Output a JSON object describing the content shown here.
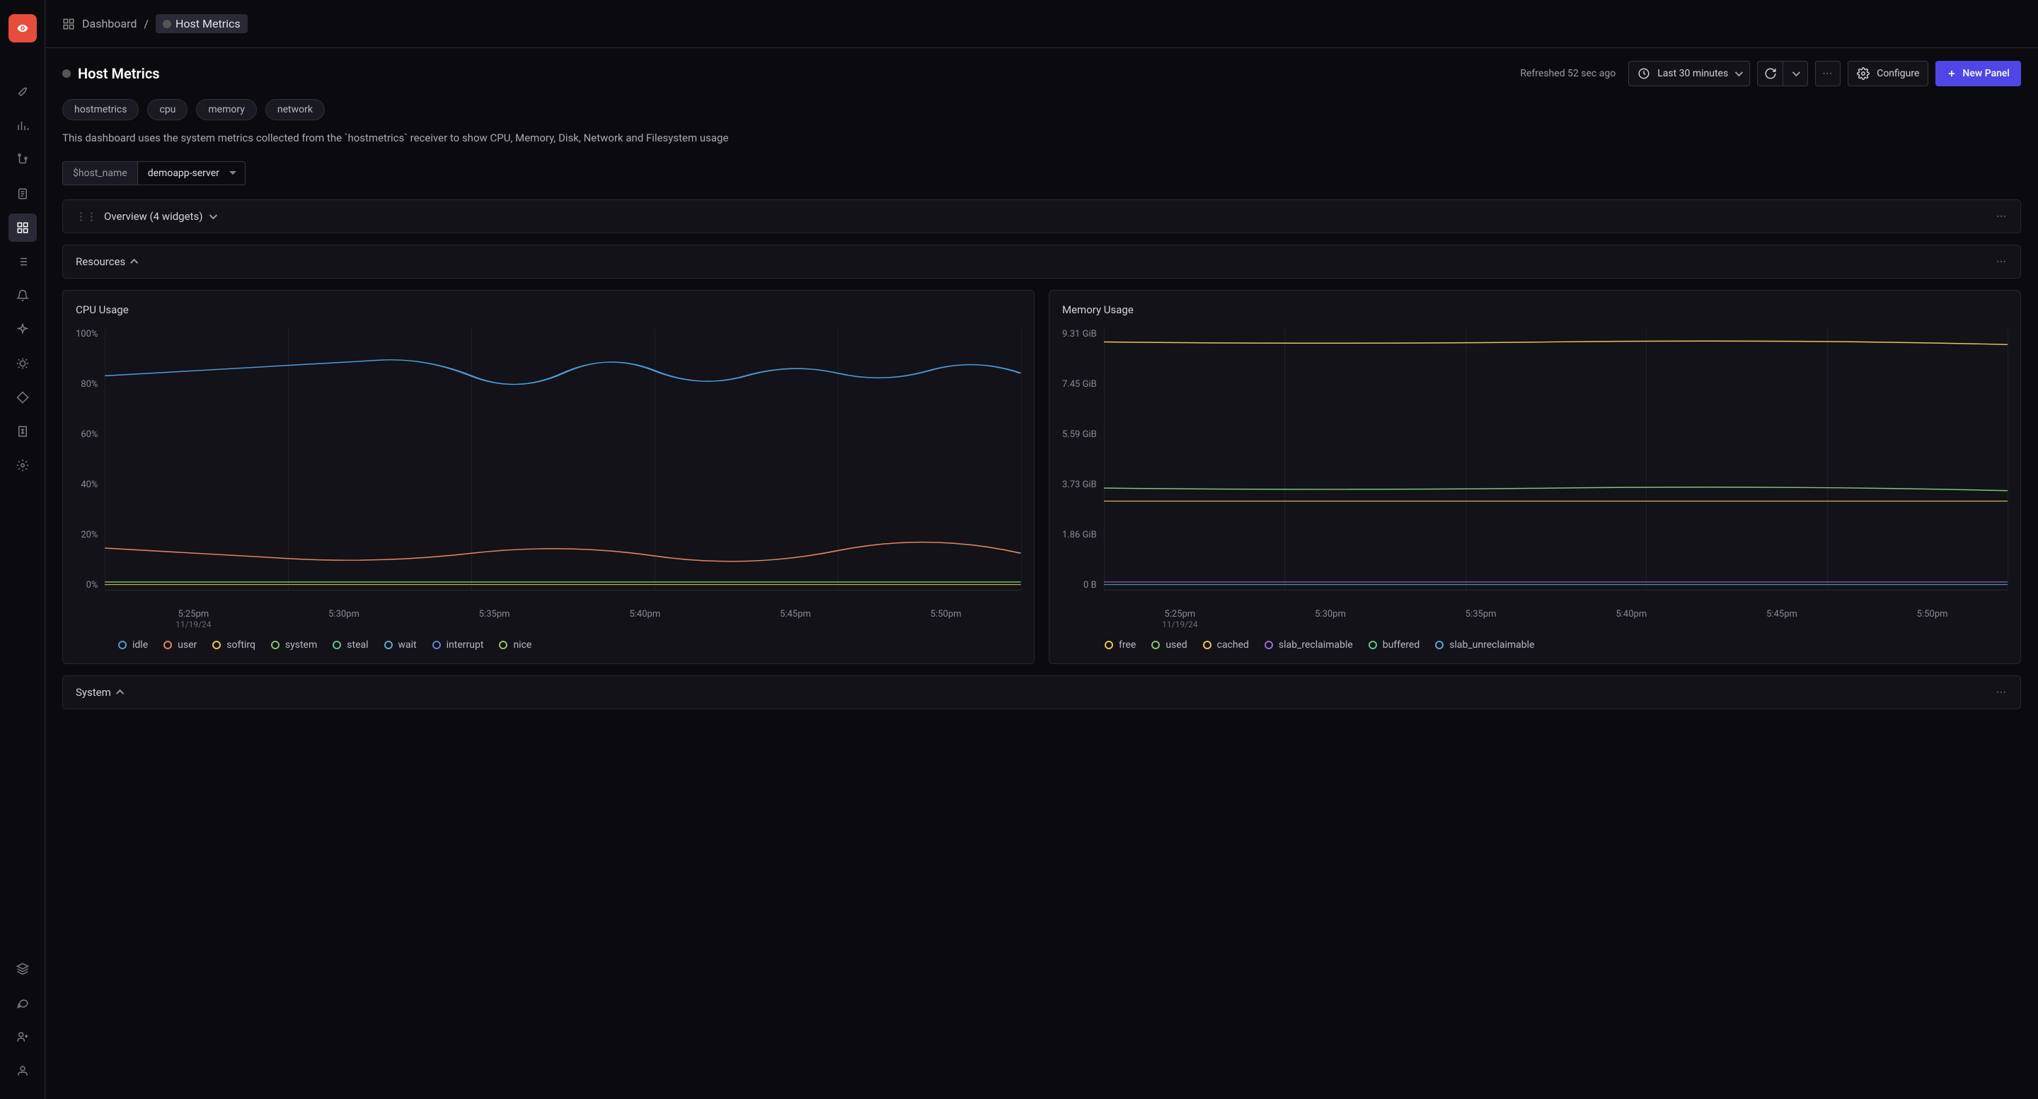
{
  "breadcrumb": {
    "root": "Dashboard",
    "sep": "/",
    "current": "Host Metrics"
  },
  "page": {
    "title": "Host Metrics",
    "refreshed": "Refreshed 52 sec ago",
    "time_range": "Last 30 minutes",
    "configure": "Configure",
    "new_panel": "New Panel",
    "description": "This dashboard uses the system metrics collected from the `hostmetrics` receiver to show CPU, Memory, Disk, Network and Filesystem usage"
  },
  "tags": [
    "hostmetrics",
    "cpu",
    "memory",
    "network"
  ],
  "variable": {
    "label": "$host_name",
    "value": "demoapp-server"
  },
  "sections": {
    "overview": "Overview (4 widgets)",
    "resources": "Resources",
    "system": "System"
  },
  "cpu_chart": {
    "title": "CPU Usage",
    "y_ticks": [
      "100%",
      "80%",
      "60%",
      "40%",
      "20%",
      "0%"
    ],
    "x_ticks": [
      "5:25pm",
      "5:30pm",
      "5:35pm",
      "5:40pm",
      "5:45pm",
      "5:50pm"
    ],
    "x_date": "11/19/24",
    "legend": [
      {
        "name": "idle",
        "color": "#4c9bd6"
      },
      {
        "name": "user",
        "color": "#e0835f"
      },
      {
        "name": "softirq",
        "color": "#e8c35b"
      },
      {
        "name": "system",
        "color": "#7fc66e"
      },
      {
        "name": "steal",
        "color": "#5bc48e"
      },
      {
        "name": "wait",
        "color": "#5ba8c4"
      },
      {
        "name": "interrupt",
        "color": "#6b7ad6"
      },
      {
        "name": "nice",
        "color": "#9bc45b"
      }
    ]
  },
  "mem_chart": {
    "title": "Memory Usage",
    "y_ticks": [
      "9.31 GiB",
      "7.45 GiB",
      "5.59 GiB",
      "3.73 GiB",
      "1.86 GiB",
      "0 B"
    ],
    "x_ticks": [
      "5:25pm",
      "5:30pm",
      "5:35pm",
      "5:40pm",
      "5:45pm",
      "5:50pm"
    ],
    "x_date": "11/19/24",
    "legend": [
      {
        "name": "free",
        "color": "#e8c35b"
      },
      {
        "name": "used",
        "color": "#7fc66e"
      },
      {
        "name": "cached",
        "color": "#e8c35b"
      },
      {
        "name": "slab_reclaimable",
        "color": "#9b6bd6"
      },
      {
        "name": "buffered",
        "color": "#5bc48e"
      },
      {
        "name": "slab_unreclaimable",
        "color": "#5ba8c4"
      }
    ]
  },
  "chart_data": [
    {
      "type": "line",
      "title": "CPU Usage",
      "xlabel": "",
      "ylabel": "",
      "ylim": [
        0,
        100
      ],
      "x": [
        "5:25pm",
        "5:30pm",
        "5:35pm",
        "5:40pm",
        "5:45pm",
        "5:50pm"
      ],
      "series": [
        {
          "name": "idle",
          "values": [
            82,
            85,
            86,
            82,
            84,
            83
          ]
        },
        {
          "name": "user",
          "values": [
            16,
            13,
            12,
            14,
            15,
            14
          ]
        },
        {
          "name": "softirq",
          "values": [
            2,
            2,
            2,
            2,
            2,
            2
          ]
        },
        {
          "name": "system",
          "values": [
            2,
            2,
            2,
            2,
            2,
            2
          ]
        },
        {
          "name": "steal",
          "values": [
            0,
            0,
            0,
            0,
            0,
            0
          ]
        },
        {
          "name": "wait",
          "values": [
            0,
            0,
            0,
            0,
            0,
            0
          ]
        },
        {
          "name": "interrupt",
          "values": [
            0,
            0,
            0,
            0,
            0,
            0
          ]
        },
        {
          "name": "nice",
          "values": [
            0,
            0,
            0,
            0,
            0,
            0
          ]
        }
      ]
    },
    {
      "type": "line",
      "title": "Memory Usage",
      "xlabel": "",
      "ylabel": "",
      "ylim": [
        0,
        9.31
      ],
      "y_unit": "GiB",
      "x": [
        "5:25pm",
        "5:30pm",
        "5:35pm",
        "5:40pm",
        "5:45pm",
        "5:50pm"
      ],
      "series": [
        {
          "name": "free",
          "values": [
            8.9,
            8.9,
            8.9,
            8.9,
            8.9,
            8.9
          ]
        },
        {
          "name": "used",
          "values": [
            3.6,
            3.6,
            3.6,
            3.6,
            3.6,
            3.6
          ]
        },
        {
          "name": "cached",
          "values": [
            3.2,
            3.2,
            3.2,
            3.2,
            3.2,
            3.2
          ]
        },
        {
          "name": "slab_reclaimable",
          "values": [
            0.3,
            0.3,
            0.3,
            0.3,
            0.3,
            0.3
          ]
        },
        {
          "name": "buffered",
          "values": [
            0.2,
            0.2,
            0.2,
            0.2,
            0.2,
            0.2
          ]
        },
        {
          "name": "slab_unreclaimable",
          "values": [
            0.2,
            0.2,
            0.2,
            0.2,
            0.2,
            0.2
          ]
        }
      ]
    }
  ]
}
